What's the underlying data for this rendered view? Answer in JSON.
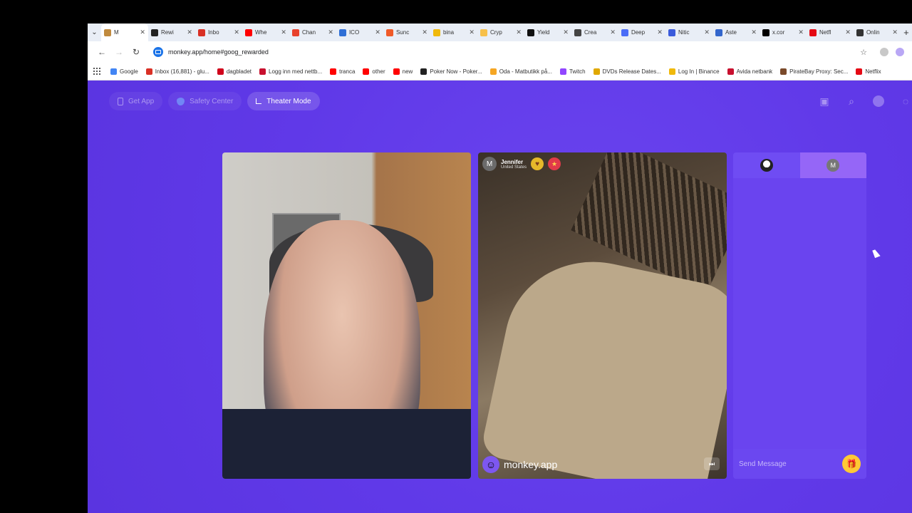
{
  "browser": {
    "tabs": [
      {
        "label": "M",
        "color": "#c08a3e",
        "active": true
      },
      {
        "label": "Rewi",
        "color": "#222222"
      },
      {
        "label": "Inbo",
        "color": "#d93025"
      },
      {
        "label": "Whe",
        "color": "#ff0000"
      },
      {
        "label": "Chan",
        "color": "#e8412c"
      },
      {
        "label": "ICO",
        "color": "#2f6fd6"
      },
      {
        "label": "Sunc",
        "color": "#f05a28"
      },
      {
        "label": "bina",
        "color": "#f0b90b"
      },
      {
        "label": "Cryp",
        "color": "#f7c04a"
      },
      {
        "label": "Yield",
        "color": "#111111"
      },
      {
        "label": "Crea",
        "color": "#444444"
      },
      {
        "label": "Deep",
        "color": "#4a6cf7"
      },
      {
        "label": "Nitic",
        "color": "#3b5bdb"
      },
      {
        "label": "Aste",
        "color": "#3366cc"
      },
      {
        "label": "x.cor",
        "color": "#000000"
      },
      {
        "label": "Netfl",
        "color": "#e50914"
      },
      {
        "label": "Onlin",
        "color": "#333333"
      }
    ],
    "url": "monkey.app/home#goog_rewarded",
    "bookmarks": [
      {
        "label": "Google",
        "color": "#4285f4"
      },
      {
        "label": "Inbox (16,881) - glu...",
        "color": "#d93025"
      },
      {
        "label": "dagbladet",
        "color": "#d0021b"
      },
      {
        "label": "Logg inn med nettb...",
        "color": "#c8102e"
      },
      {
        "label": "tranca",
        "color": "#ff0000"
      },
      {
        "label": "other",
        "color": "#ff0000"
      },
      {
        "label": "new",
        "color": "#ff0000"
      },
      {
        "label": "Poker Now - Poker...",
        "color": "#222222"
      },
      {
        "label": "Oda - Matbutikk på...",
        "color": "#f5a623"
      },
      {
        "label": "Twitch",
        "color": "#9146ff"
      },
      {
        "label": "DVDs Release Dates...",
        "color": "#e0a800"
      },
      {
        "label": "Log In | Binance",
        "color": "#f0b90b"
      },
      {
        "label": "Avida netbank",
        "color": "#c8102e"
      },
      {
        "label": "PirateBay Proxy: Sec...",
        "color": "#7a4a2a"
      },
      {
        "label": "Netflix",
        "color": "#e50914"
      }
    ]
  },
  "app": {
    "nav": {
      "get_app": "Get App",
      "safety_center": "Safety Center",
      "theater_mode": "Theater Mode"
    },
    "peer": {
      "avatar_letter": "M",
      "name": "Jennifer",
      "country": "United States"
    },
    "watermark": "monkey.app",
    "chat": {
      "peer_avatar_letter": "M",
      "input_placeholder": "Send Message"
    },
    "colors": {
      "background": "#6039e8",
      "accent": "#ffc935"
    }
  }
}
